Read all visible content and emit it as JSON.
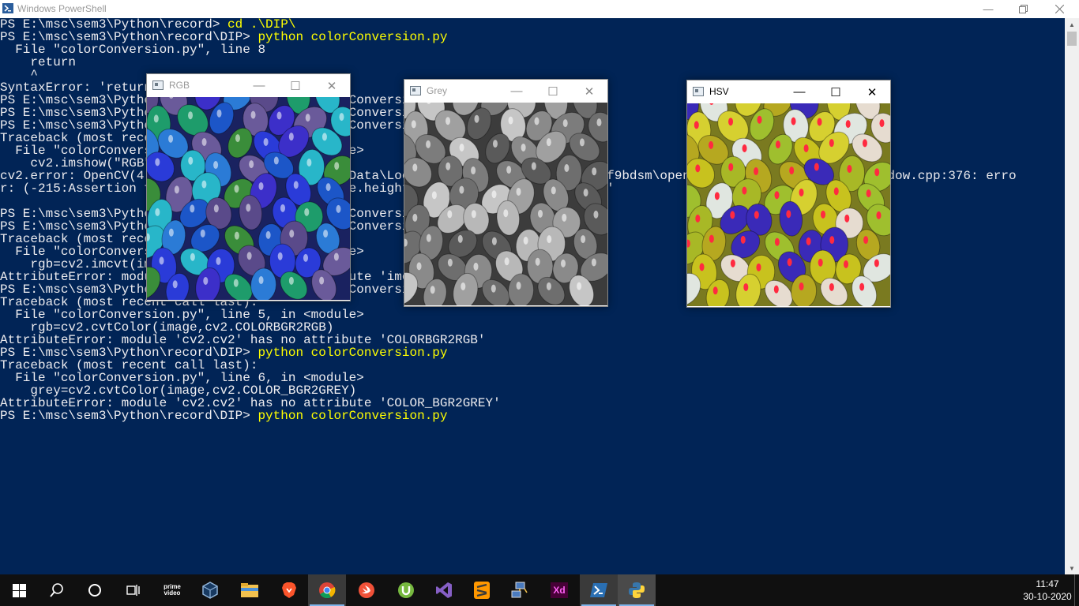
{
  "powershell": {
    "title": "Windows PowerShell",
    "lines": [
      {
        "prompt": "PS E:\\msc\\sem3\\Python\\record> ",
        "command": "cd .\\DIP\\"
      },
      {
        "prompt": "PS E:\\msc\\sem3\\Python\\record\\DIP> ",
        "command": "python colorConversion.py"
      },
      {
        "text": "  File \"colorConversion.py\", line 8"
      },
      {
        "text": "    return"
      },
      {
        "text": "    ^"
      },
      {
        "text": "SyntaxError: 'return' outside function"
      },
      {
        "text": "PS E:\\msc\\sem3\\Python\\record\\DIP> python colorConversion.py"
      },
      {
        "text": "PS E:\\msc\\sem3\\Python\\record\\DIP> python colorConversion.py"
      },
      {
        "text": "PS E:\\msc\\sem3\\Python\\record\\DIP> python colorConversion.py"
      },
      {
        "text": "Traceback (most recent call last):"
      },
      {
        "text": "  File \"colorConversion.py\", line 4, in <module>"
      },
      {
        "text": "    cv2.imshow(\"RGB\",rgb)"
      },
      {
        "text": "cv2.error: OpenCV(4.4.0) C:\\Users\\appveyor\\AppData\\Local\\Temp\\1\\pip-req-build-cff9bdsm\\opencv\\modules\\highgui\\src\\window.cpp:376: erro"
      },
      {
        "text": "r: (-215:Assertion failed) size.width>0 && size.height>0 in function 'cv::imshow'"
      },
      {
        "text": ""
      },
      {
        "text": "PS E:\\msc\\sem3\\Python\\record\\DIP> python colorConversion.py"
      },
      {
        "text": "PS E:\\msc\\sem3\\Python\\record\\DIP> python colorConversion.py"
      },
      {
        "text": "Traceback (most recent call last):"
      },
      {
        "text": "  File \"colorConversion.py\", line 5, in <module>"
      },
      {
        "text": "    rgb=cv2.imcvt(image,cv2.COLOR_BGR2RGB)"
      },
      {
        "text": "AttributeError: module 'cv2.cv2' has no attribute 'imcvt'"
      },
      {
        "text": "PS E:\\msc\\sem3\\Python\\record\\DIP> python colorConversion.py"
      },
      {
        "text": "Traceback (most recent call last):"
      },
      {
        "text": "  File \"colorConversion.py\", line 5, in <module>"
      },
      {
        "text": "    rgb=cv2.cvtColor(image,cv2.COLORBGR2RGB)"
      },
      {
        "text": "AttributeError: module 'cv2.cv2' has no attribute 'COLORBGR2RGB'"
      },
      {
        "prompt": "PS E:\\msc\\sem3\\Python\\record\\DIP> ",
        "command": "python colorConversion.py"
      },
      {
        "text": "Traceback (most recent call last):"
      },
      {
        "text": "  File \"colorConversion.py\", line 6, in <module>"
      },
      {
        "text": "    grey=cv2.cvtColor(image,cv2.COLOR_BGR2GREY)"
      },
      {
        "text": "AttributeError: module 'cv2.cv2' has no attribute 'COLOR_BGR2GREY'"
      },
      {
        "prompt": "PS E:\\msc\\sem3\\Python\\record\\DIP> ",
        "command": "python colorConversion.py"
      }
    ],
    "colors": {
      "background": "#012456",
      "text": "#eeedf0",
      "command": "#ffff00"
    }
  },
  "windows": {
    "rgb": {
      "title": "RGB"
    },
    "grey": {
      "title": "Grey"
    },
    "hsv": {
      "title": "HSV"
    }
  },
  "taskbar": {
    "apps": [
      "start-icon",
      "search-icon",
      "task-view-icon",
      "task-manager-icon",
      "prime-video-icon",
      "virtualbox-icon",
      "file-explorer-icon",
      "brave-icon",
      "chrome-icon",
      "swift-icon",
      "utorrent-icon",
      "visual-studio-icon",
      "sublime-text-icon",
      "network-icon",
      "adobe-xd-icon",
      "powershell-icon",
      "python-icon"
    ],
    "prime_label": "prime video",
    "xd_label": "Xd",
    "time": "11:47",
    "date": "30-10-2020"
  }
}
